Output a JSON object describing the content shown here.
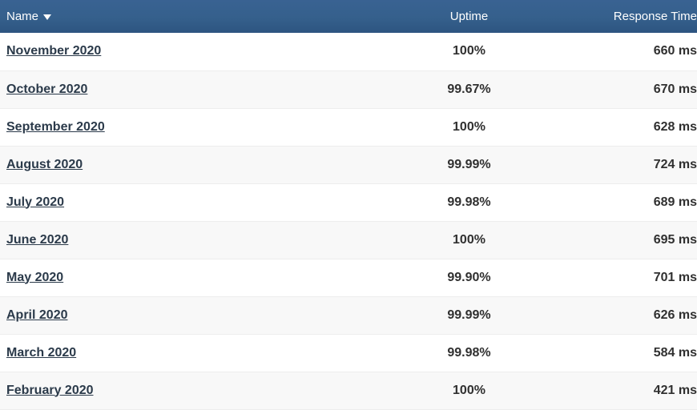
{
  "table": {
    "columns": [
      {
        "key": "name",
        "label": "Name",
        "sorted": true,
        "sort_direction": "desc",
        "sort_icon": "caret-down-icon",
        "align": "left"
      },
      {
        "key": "uptime",
        "label": "Uptime",
        "sorted": false,
        "align": "center"
      },
      {
        "key": "response_time",
        "label": "Response Time",
        "sorted": false,
        "align": "right"
      }
    ],
    "header_background": "#35608c",
    "header_text_color": "#ffffff",
    "row_alt_background": "#f8f8f8",
    "link_color": "#2b3a4a",
    "rows": [
      {
        "name": "November 2020",
        "uptime": "100%",
        "response_time": "660 ms"
      },
      {
        "name": "October 2020",
        "uptime": "99.67%",
        "response_time": "670 ms"
      },
      {
        "name": "September 2020",
        "uptime": "100%",
        "response_time": "628 ms"
      },
      {
        "name": "August 2020",
        "uptime": "99.99%",
        "response_time": "724 ms"
      },
      {
        "name": "July 2020",
        "uptime": "99.98%",
        "response_time": "689 ms"
      },
      {
        "name": "June 2020",
        "uptime": "100%",
        "response_time": "695 ms"
      },
      {
        "name": "May 2020",
        "uptime": "99.90%",
        "response_time": "701 ms"
      },
      {
        "name": "April 2020",
        "uptime": "99.99%",
        "response_time": "626 ms"
      },
      {
        "name": "March 2020",
        "uptime": "99.98%",
        "response_time": "584 ms"
      },
      {
        "name": "February 2020",
        "uptime": "100%",
        "response_time": "421 ms"
      }
    ]
  }
}
